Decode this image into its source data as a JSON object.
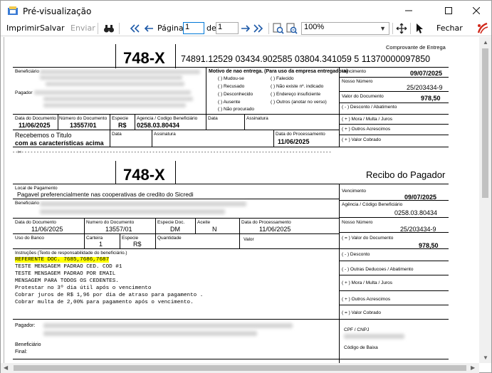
{
  "window": {
    "title": "Pré-visualização"
  },
  "toolbar": {
    "print": "Imprimir",
    "save": "Salvar",
    "send": "Enviar",
    "page_label": "Página",
    "page_value": "1",
    "of_label": "de",
    "total_value": "1",
    "zoom_value": "100%",
    "close": "Fechar"
  },
  "receipt1": {
    "header": "Comprovante de Entrega",
    "bank_code": "748-X",
    "digitable_line": "74891.12529 03434.902585 03804.341059 5 11370000097850",
    "beneficiario_label": "Beneficiário",
    "pagador_label": "Pagador",
    "motivo_title": "Motivo de nao entrega. (Para uso da empresa entregadora)",
    "motivos": [
      "( ) Mudou-se",
      "( ) Falecido",
      "( ) Recusado",
      "( ) Não existe nº. indicado",
      "( ) Desconhecido",
      "( ) Endereço insuficiente",
      "( ) Ausente",
      "( ) Outros (anotar no verso)",
      "( ) Não procurado"
    ],
    "vencimento_label": "Vencimento",
    "vencimento": "09/07/2025",
    "nosso_numero_label": "Nosso Número",
    "nosso_numero": "25/203434-9",
    "valor_documento_label": "Valor do Documento",
    "valor_documento": "978,50",
    "desconto_label": "( - ) Desconto / Abatimento",
    "mora_label": "( + ) Mora / Multa / Juros",
    "outros_label": "( + ) Outros Acrescimos",
    "cobrado_label": "( + ) Valor Cobrado",
    "data_documento_label": "Data do Documento",
    "data_documento": "11/06/2025",
    "numero_documento_label": "Número do Documento",
    "numero_documento": "13557/01",
    "especie_label": "Especie",
    "especie": "R$",
    "agencia_label": "Agencia / Codigo Beneficiário",
    "agencia": "0258.03.80434",
    "data_label": "Data",
    "assinatura_label": "Assinatura",
    "recebemos_line1": "Recebemos o Titulo",
    "recebemos_line2": "com as características acima",
    "data2_label": "Data",
    "assinatura2_label": "Assinatura",
    "data_processamento_label": "Data do Processamento",
    "data_processamento": "11/06/2025",
    "cut_mark": "- -✂- - - - - - - - - - - - - - - - - - - - - - - - - - - - - - - - - - - - - - - - - - - - - - - - - - - - - - - - - - - - - - - - - - - - - - - - - - - - - - - - - - - - - - - - - - - - - - - - - - - - - -"
  },
  "receipt2": {
    "bank_code": "748-X",
    "title": "Recibo do Pagador",
    "local_pagamento_label": "Local de Pagamento",
    "local_pagamento": "Pagavel preferencialmente nas cooperativas de credito do Sicredi",
    "vencimento_label": "Vencimento",
    "vencimento": "09/07/2025",
    "beneficiario_label": "Beneficiário",
    "agencia_label": "Agência / Código Beneficiário",
    "agencia": "0258.03.80434",
    "data_documento_label": "Data do Documento",
    "data_documento": "11/06/2025",
    "numero_documento_label": "Numero do Documento",
    "numero_documento": "13557/01",
    "especie_doc_label": "Especie Doc.",
    "especie_doc": "DM",
    "aceite_label": "Aceite",
    "aceite": "N",
    "data_processamento_label": "Data do Processamento",
    "data_processamento": "11/06/2025",
    "nosso_numero_label": "Nosso Número",
    "nosso_numero": "25/203434-9",
    "uso_banco_label": "Uso do Banco",
    "carteira_label": "Carteira",
    "carteira": "1",
    "especie_label": "Especie",
    "especie": "R$",
    "quantidade_label": "Quantidade",
    "valor_label": "Valor",
    "valor_documento_label": "( = ) Valor do Documento",
    "valor_documento": "978,50",
    "instrucoes_label": "Instruções (Texto de responsabilidade do beneficiário.)",
    "instrucoes": [
      "REFERENTE DOC. 7685,7686,7687",
      "TESTE MENSAGEM PADRAO CED. COD #1",
      "TESTE MENSAGEM PADRAO POR EMAIL",
      "MENSAGEM PARA TODOS OS CEDENTES.",
      "Protestar no 3º dia útil após o vencimento",
      "Cobrar juros de R$ 1,96 por dia de atraso para pagamento .",
      "Cobrar multa de 2,00%  para pagamento após o vencimento."
    ],
    "desconto_label": "( - ) Desconto",
    "outras_deducoes_label": "( - ) Outras Deducoes / Abatimento",
    "mora_label": "( + ) Mora / Multa / Juros",
    "outros_acrescimos_label": "( + ) Outros Acrescimos",
    "valor_cobrado_label": "( = ) Valor Cobrado",
    "pagador_label": "Pagador:",
    "cpf_label": "CPF / CNPJ",
    "beneficiario_final_label1": "Beneficiário",
    "beneficiario_final_label2": "Final:",
    "codigo_baixa_label": "Código de Baixa"
  }
}
